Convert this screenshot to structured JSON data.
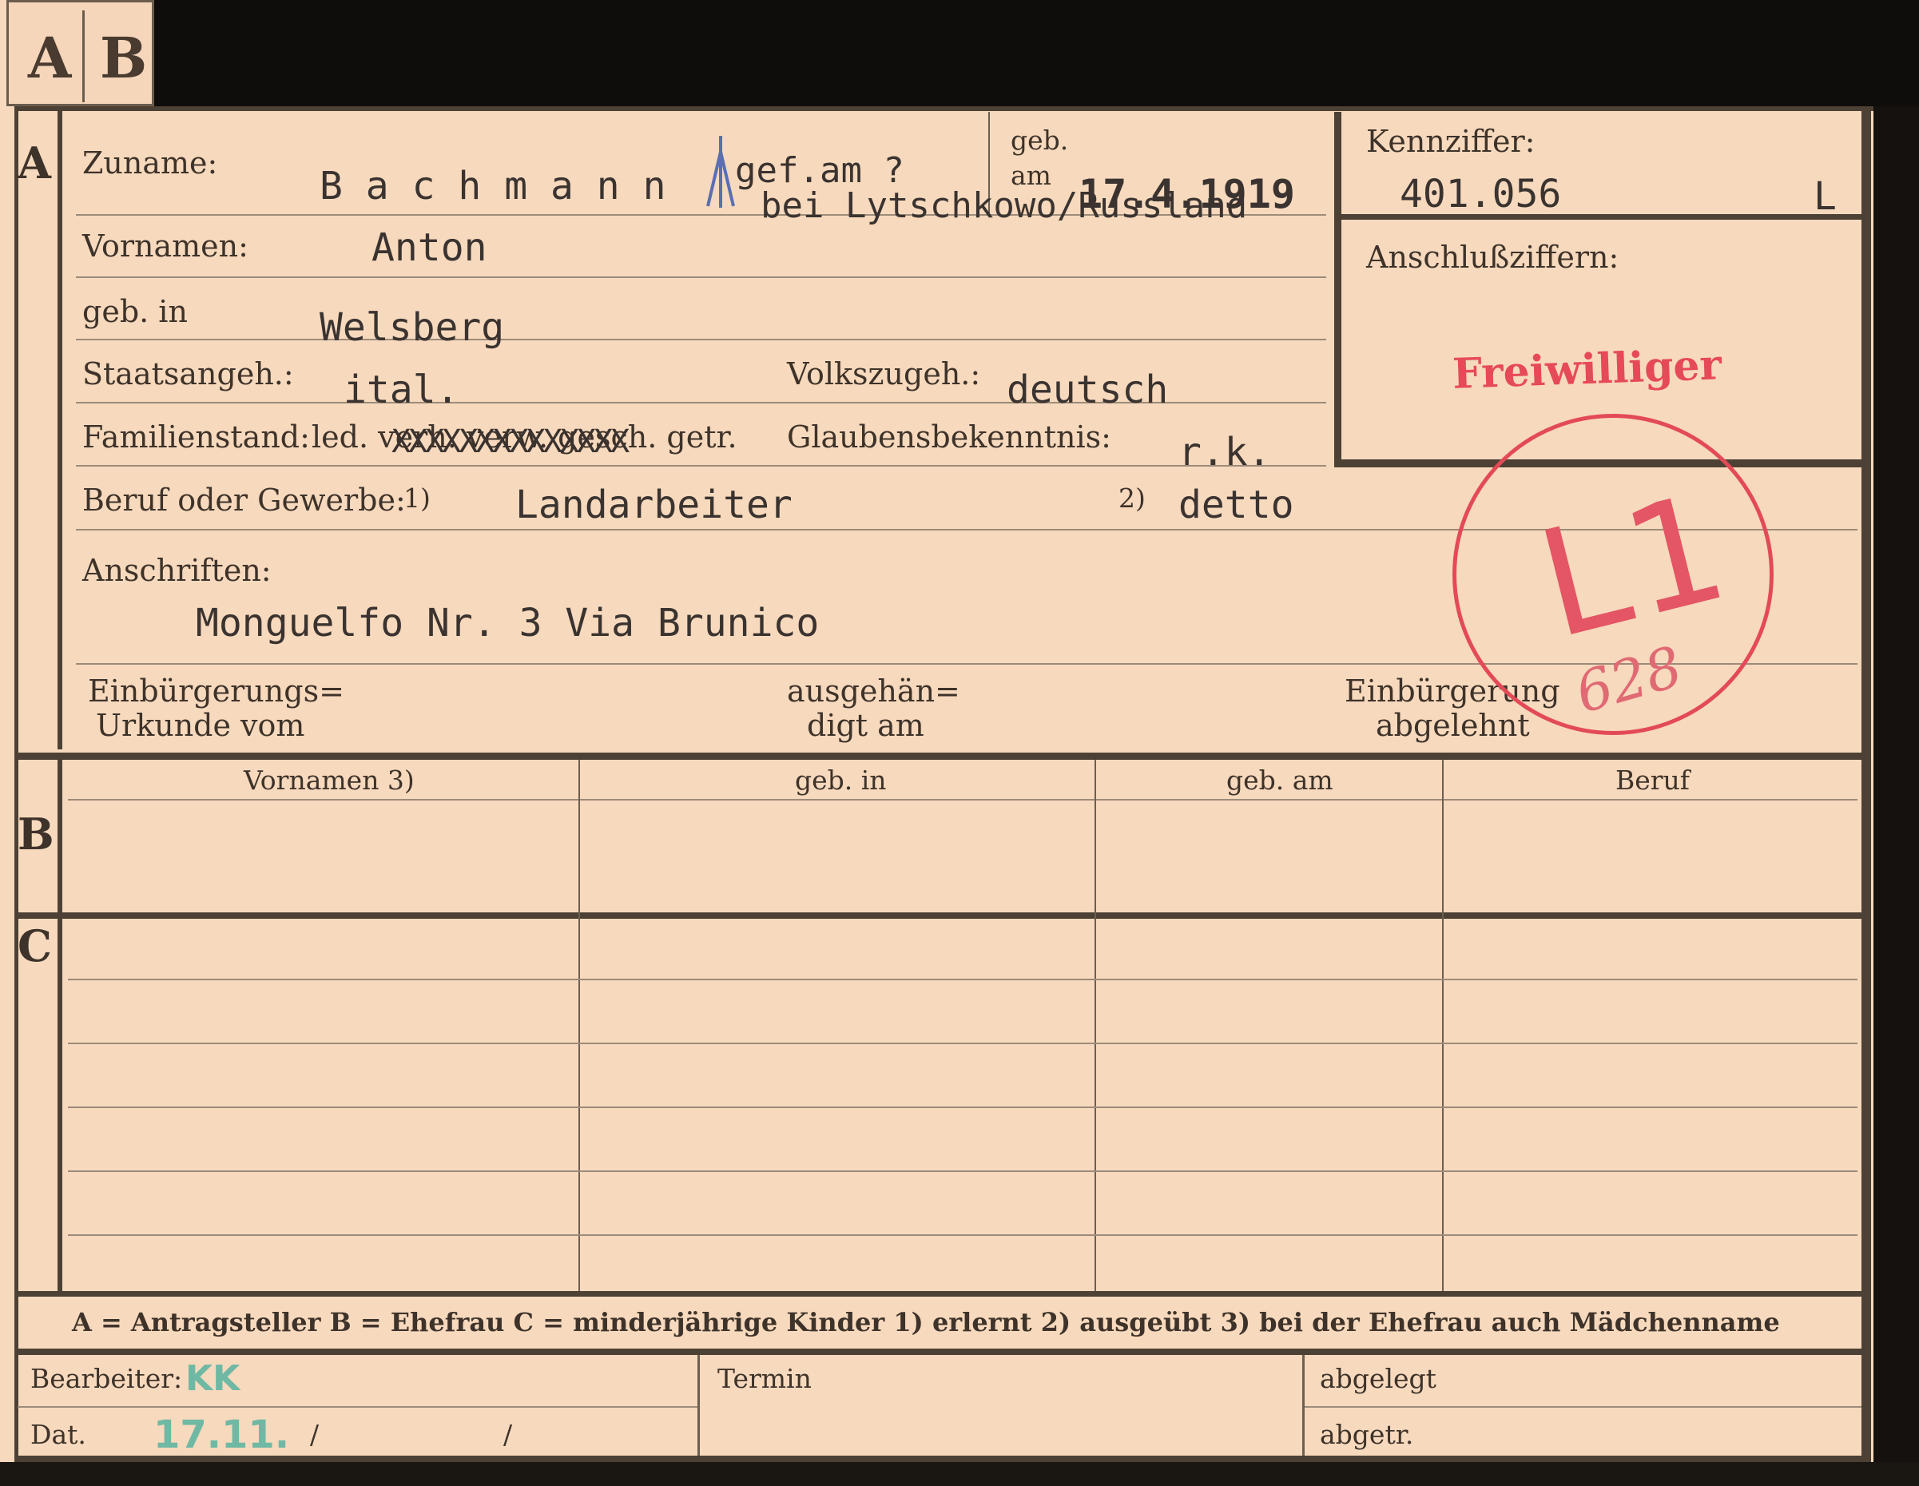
{
  "tabs": [
    "A",
    "B"
  ],
  "sections": {
    "a": "A",
    "b": "B",
    "c": "C"
  },
  "labels": {
    "zuname": "Zuname:",
    "geb_am_top": "geb.",
    "geb_am_bottom": "am",
    "kennziffer": "Kennziffer:",
    "anschlussziffern": "Anschlußziffern:",
    "vornamen": "Vornamen:",
    "geb_in": "geb. in",
    "staatsangeh": "Staatsangeh.:",
    "volkszugeh": "Volkszugeh.:",
    "familienstand": "Familienstand:",
    "familienstand_options": "led. verh. verw. gesch. getr.",
    "glaubensbekenntnis": "Glaubensbekenntnis:",
    "beruf": "Beruf oder Gewerbe:",
    "beruf_note1": "1)",
    "beruf_note2": "2)",
    "anschriften": "Anschriften:",
    "einbuergerung_l1": "Einbürgerungs=",
    "einbuergerung_l2": "Urkunde vom",
    "ausgehaendigt_l1": "ausgehän=",
    "ausgehaendigt_l2": "digt am",
    "abgelehnt_l1": "Einbürgerung",
    "abgelehnt_l2": "abgelehnt"
  },
  "values": {
    "zuname": "B a c h m a n n",
    "death_note_line1": "gef.am ?",
    "death_note_line2": "bei Lytschkowo/Russland",
    "geb_am": "17.4.1919",
    "kennziffer": "401.056",
    "kennziffer_suffix": "L",
    "vornamen": "Anton",
    "geb_in": "Welsberg",
    "staatsangeh": "ital.",
    "volkszugeh": "deutsch",
    "familienstand_strike": "XXXXXXXXXXXXXX",
    "glaubensbekenntnis": "r.k.",
    "beruf_erlernt": "Landarbeiter",
    "beruf_ausgeuebt": "detto",
    "anschrift": "Monguelfo Nr. 3 Via Brunico"
  },
  "stamps": {
    "freiwilliger": "Freiwilliger",
    "circle_code": "L1",
    "circle_number": "628"
  },
  "table_headers": [
    "Vornamen 3)",
    "geb. in",
    "geb. am",
    "Beruf"
  ],
  "footer": {
    "legend": "A = Antragsteller   B = Ehefrau   C = minderjährige Kinder   1) erlernt   2) ausgeübt   3) bei der Ehefrau auch Mädchenname",
    "bearbeiter": "Bearbeiter:",
    "bearbeiter_initials": "KK",
    "termin": "Termin",
    "abgelegt": "abgelegt",
    "dat": "Dat.",
    "dat_value": "17.11.",
    "slash1": "/",
    "slash2": "/",
    "abgetr": "abgetr."
  },
  "colors": {
    "stamp_red": "#e34a57",
    "ink_green": "#6fb9a4",
    "card": "#f7d9bd"
  }
}
